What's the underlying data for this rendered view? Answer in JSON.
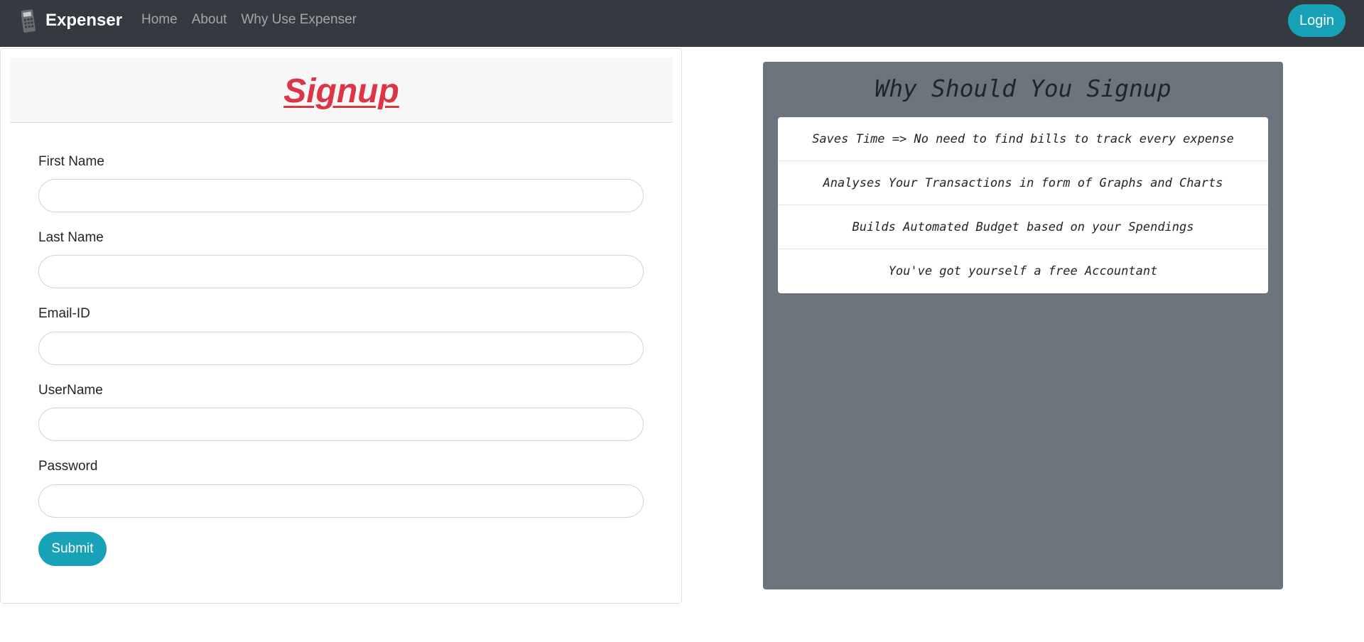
{
  "navbar": {
    "brand": "Expenser",
    "links": [
      "Home",
      "About",
      "Why Use Expenser"
    ],
    "login_label": "Login"
  },
  "signup": {
    "title": "Signup",
    "fields": {
      "first_name": {
        "label": "First Name",
        "value": ""
      },
      "last_name": {
        "label": "Last Name",
        "value": ""
      },
      "email": {
        "label": "Email-ID",
        "value": ""
      },
      "username": {
        "label": "UserName",
        "value": ""
      },
      "password": {
        "label": "Password",
        "value": ""
      }
    },
    "submit_label": "Submit"
  },
  "why": {
    "title": "Why Should You Signup",
    "reasons": [
      "Saves Time => No need to find bills to track every expense",
      "Analyses Your Transactions in form of Graphs and Charts",
      "Builds Automated Budget based on your Spendings",
      "You've got yourself a free Accountant"
    ]
  },
  "colors": {
    "navbar_bg": "#343a40",
    "accent": "#17a2b8",
    "title_red": "#dc3545",
    "panel_gray": "#6c757d"
  }
}
